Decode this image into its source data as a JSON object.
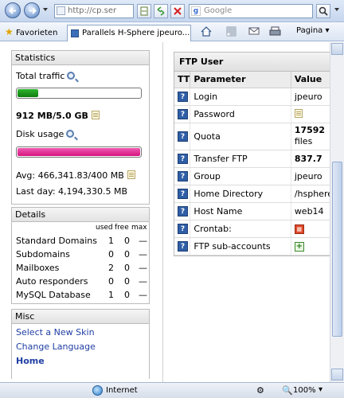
{
  "browser": {
    "url": "http://cp.ser",
    "search_placeholder": "Google",
    "favorites_label": "Favorieten",
    "tab_title": "Parallels H-Sphere  jpeuro...",
    "page_menu": "Pagina",
    "status_zone": "Internet",
    "zoom": "100%"
  },
  "statistics": {
    "title": "Statistics",
    "total_traffic_label": "Total traffic",
    "traffic_value": "912 MB/5.0 GB",
    "traffic_fraction": 0.18,
    "disk_usage_label": "Disk usage",
    "disk_fraction": 1.0,
    "avg_line": "Avg: 466,341.83/400 MB",
    "last_day_line": "Last day: 4,194,330.5 MB",
    "colors": {
      "traffic_bar": "#2fb52f",
      "disk_bar": "#d4147f"
    }
  },
  "details": {
    "title": "Details",
    "columns": [
      "used",
      "free",
      "max"
    ],
    "rows": [
      {
        "name": "Standard Domains",
        "used": "1",
        "free": "0",
        "max": "—"
      },
      {
        "name": "Subdomains",
        "used": "0",
        "free": "0",
        "max": "—"
      },
      {
        "name": "Mailboxes",
        "used": "2",
        "free": "0",
        "max": "—"
      },
      {
        "name": "Auto responders",
        "used": "0",
        "free": "0",
        "max": "—"
      },
      {
        "name": "MySQL Database",
        "used": "1",
        "free": "0",
        "max": "—"
      }
    ]
  },
  "misc": {
    "title": "Misc",
    "links": [
      "Select a New Skin",
      "Change Language",
      "Home"
    ]
  },
  "ftp": {
    "title": "FTP User",
    "headers": [
      "TT",
      "Parameter",
      "Value"
    ],
    "rows": [
      {
        "param": "Login",
        "value": "jpeuro"
      },
      {
        "param": "Password",
        "value": ""
      },
      {
        "param": "Quota",
        "value": "17592",
        "value2": "files"
      },
      {
        "param": "Transfer FTP",
        "value": "837.7"
      },
      {
        "param": "Group",
        "value": "jpeuro"
      },
      {
        "param": "Home Directory",
        "value": "/hsphere"
      },
      {
        "param": "Host Name",
        "value": "web14"
      },
      {
        "param": "Crontab:",
        "value": ""
      },
      {
        "param": "FTP sub-accounts",
        "value": ""
      }
    ]
  }
}
